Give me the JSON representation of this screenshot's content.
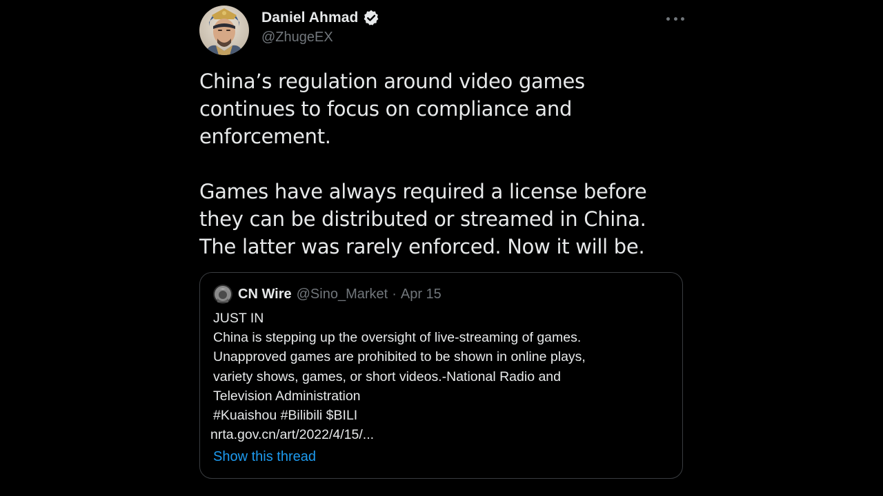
{
  "tweet": {
    "author": {
      "display_name": "Daniel Ahmad",
      "handle": "@ZhugeEX",
      "verified": true,
      "avatar_icon": "avatar-image"
    },
    "more_icon": "more-options-icon",
    "text": {
      "paragraph_1": "China’s regulation around video games\ncontinues to focus on compliance and\nenforcement.",
      "paragraph_2": "Games have always required a license before\nthey can be distributed or streamed in China.\nThe latter was rarely enforced. Now it will be."
    }
  },
  "quote": {
    "author": {
      "display_name": "CN Wire",
      "handle": "@Sino_Market",
      "separator": "·",
      "date": "Apr 15"
    },
    "lines": [
      "JUST IN",
      "China is stepping up the oversight of live-streaming of games.",
      "Unapproved games are prohibited to be shown in online plays,",
      "variety shows, games, or short videos.-National Radio and",
      "Television Administration",
      "#Kuaishou #Bilibili $BILI"
    ],
    "link": "nrta.gov.cn/art/2022/4/15/...",
    "show_thread": "Show this thread"
  },
  "colors": {
    "background": "#000000",
    "text_primary": "#e7e9ea",
    "text_secondary": "#71767b",
    "link": "#1d9bf0",
    "verified_badge": "#e7e9ea",
    "card_border": "#3a3d41"
  }
}
